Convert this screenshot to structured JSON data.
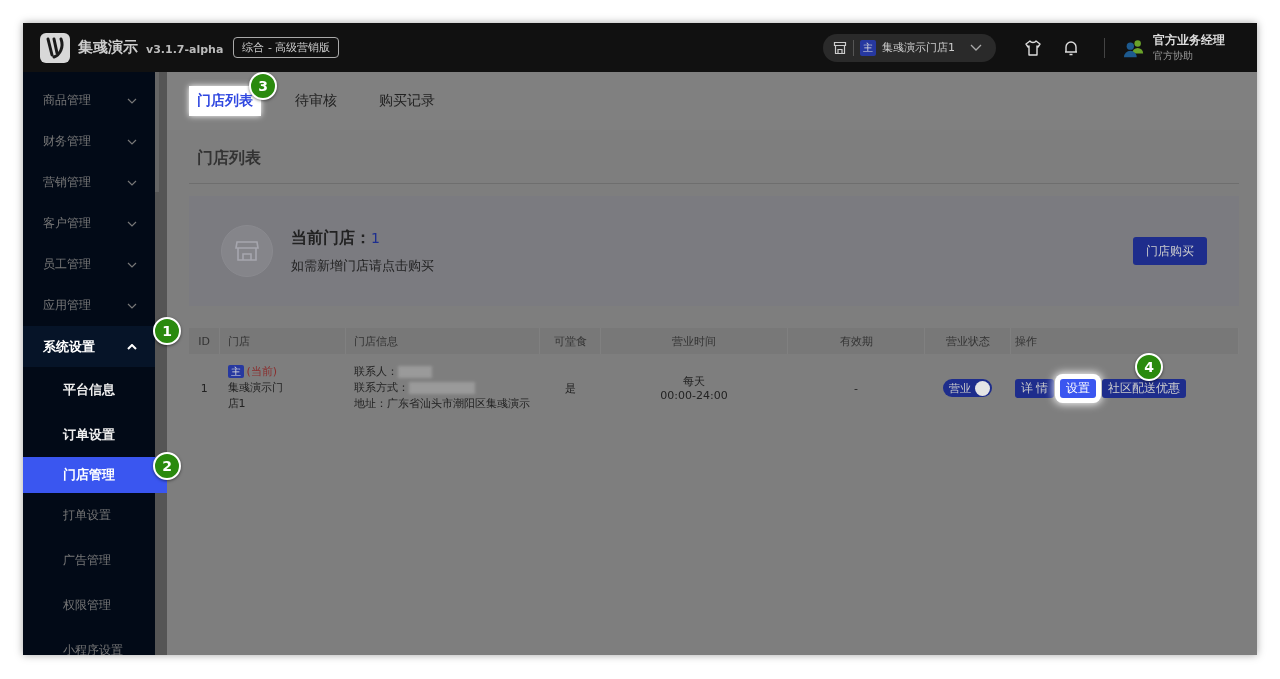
{
  "header": {
    "brand": "集彧演示",
    "version": "v3.1.7-alpha",
    "edition": "综合 - 高级营销版",
    "store": {
      "tag": "主",
      "name": "集彧演示门店1"
    },
    "user": {
      "name": "官方业务经理",
      "role": "官方协助"
    }
  },
  "sidebar": {
    "items": [
      {
        "label": "商品管理",
        "expanded": false,
        "spotlit": false
      },
      {
        "label": "财务管理",
        "expanded": false,
        "spotlit": false
      },
      {
        "label": "营销管理",
        "expanded": false,
        "spotlit": false
      },
      {
        "label": "客户管理",
        "expanded": false,
        "spotlit": false
      },
      {
        "label": "员工管理",
        "expanded": false,
        "spotlit": false
      },
      {
        "label": "应用管理",
        "expanded": false,
        "spotlit": false
      },
      {
        "label": "系统设置",
        "expanded": true,
        "spotlit": true,
        "children": [
          {
            "label": "平台信息",
            "selected": false,
            "spotlit": true
          },
          {
            "label": "订单设置",
            "selected": false,
            "spotlit": true
          },
          {
            "label": "门店管理",
            "selected": true,
            "spotlit": true
          },
          {
            "label": "打单设置",
            "selected": false,
            "spotlit": false
          },
          {
            "label": "广告管理",
            "selected": false,
            "spotlit": false
          },
          {
            "label": "权限管理",
            "selected": false,
            "spotlit": false
          },
          {
            "label": "小程序设置",
            "selected": false,
            "spotlit": false
          }
        ]
      }
    ]
  },
  "tabs": [
    {
      "label": "门店列表",
      "selected": true,
      "spotlit": true
    },
    {
      "label": "待审核",
      "selected": false,
      "spotlit": false
    },
    {
      "label": "购买记录",
      "selected": false,
      "spotlit": false
    }
  ],
  "section_title": "门店列表",
  "current_store": {
    "label": "当前门店：",
    "count": "1",
    "hint": "如需新增门店请点击购买",
    "button": "门店购买"
  },
  "table": {
    "columns": [
      "ID",
      "门店",
      "门店信息",
      "可堂食",
      "营业时间",
      "有效期",
      "营业状态",
      "操作"
    ],
    "rows": [
      {
        "id": "1",
        "tag": "主",
        "current": "(当前)",
        "name": "集彧演示门店1",
        "contact_label": "联系人：",
        "phone_label": "联系方式：",
        "address": "地址：广东省汕头市潮阳区集彧演示",
        "dine_in": "是",
        "hours": [
          "每天",
          "00:00-24:00"
        ],
        "validity": "-",
        "status": {
          "label": "营业",
          "on": true
        },
        "actions": [
          {
            "label": "详 情",
            "spotlit": false
          },
          {
            "label": "设置",
            "spotlit": true
          },
          {
            "label": "社区配送优惠",
            "spotlit": false
          }
        ]
      }
    ]
  },
  "callouts": [
    {
      "label": "1"
    },
    {
      "label": "2"
    },
    {
      "label": "3"
    },
    {
      "label": "4"
    }
  ]
}
